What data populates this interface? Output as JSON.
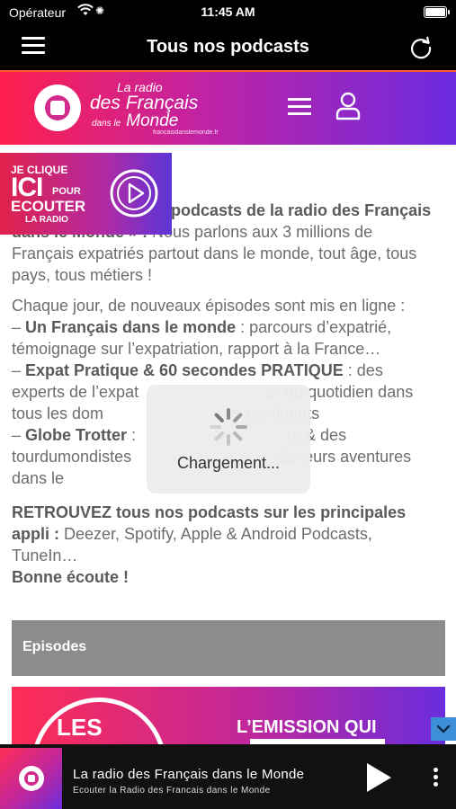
{
  "status_bar": {
    "carrier": "Opérateur",
    "time": "11:45 AM"
  },
  "nav": {
    "title": "Tous nos podcasts"
  },
  "site_header": {
    "logo_line1": "La radio",
    "logo_line2": "des Français",
    "logo_line3a": "dans le",
    "logo_line3b": "Monde",
    "logo_url": "francaisdanslemonde.fr"
  },
  "cta_banner": {
    "line1": "JE CLIQUE",
    "line2": "ICI",
    "line2b": "POUR",
    "line3": "ECOUTER",
    "line4": "LA RADIO"
  },
  "article": {
    "p1_bold": "podcasts de la radio des Français dans le Monde » :",
    "p1_text": " Nous parlons aux 3 millions de Français expatriés partout dans le monde, tout âge, tous pays, tous métiers !",
    "p2_intro": "Chaque jour, de nouveaux épisodes sont mis en ligne :",
    "p2_dash1": "– ",
    "p2_item1_bold": "Un Français dans le monde",
    "p2_item1_text": " : parcours d’expatrié, témoignage sur l’expatriation, rapport à la France…",
    "p2_dash2": "– ",
    "p2_item2_bold": "Expat Pratique & 60 secondes PRATIQUE",
    "p2_item2_text": " : des experts de l’expat",
    "p2_item2_tail": "er au quotidien dans tous les dom",
    "p2_item2_tail2": "s continents",
    "p2_dash3": "–  ",
    "p2_item3_bold": "Globe Trotter",
    "p2_item3_text": " :",
    "p2_item3_tail": "rs & des tourdumondistes",
    "p2_item3_tail2": "ès leurs aventures dans le",
    "p3_bold": "RETROUVEZ tous nos podcasts sur les principales appli :",
    "p3_text": " Deezer, Spotify, Apple & Android Podcasts, TuneIn…",
    "p3_end": "Bonne écoute !"
  },
  "episodes": {
    "label": "Episodes"
  },
  "promo": {
    "left_text": "LES",
    "right_text": "L’EMISSION QUI"
  },
  "loading": {
    "label": "Chargement..."
  },
  "player": {
    "title": "La radio des Français dans le Monde",
    "subtitle": "Ecouter la Radio des Francais dans le Monde"
  },
  "colors": {
    "brand_pink": "#ff1f4d",
    "brand_purple": "#6b2be0",
    "episodes_bg": "#8c8c8c"
  }
}
